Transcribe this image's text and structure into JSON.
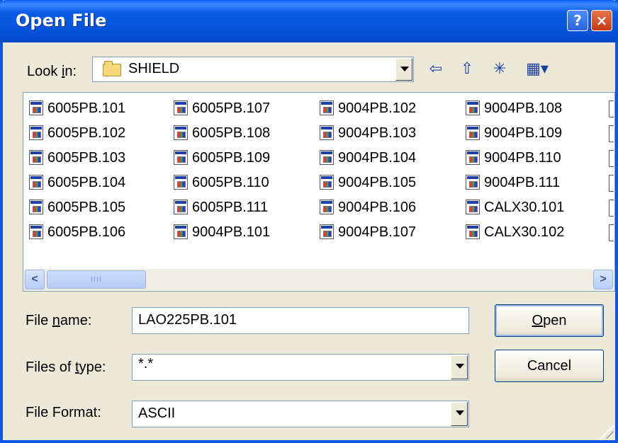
{
  "dialog": {
    "title": "Open File",
    "help_glyph": "?",
    "close_glyph": "×"
  },
  "look_in": {
    "label_pre": "Look ",
    "label_accel": "i",
    "label_post": "n:",
    "value": "SHIELD",
    "icon": "folder-icon"
  },
  "toolbar": {
    "back_icon": "⇦",
    "up_icon": "⇧",
    "new_folder_icon": "✳",
    "view_menu_icon": "▦▾"
  },
  "files": {
    "columns": [
      [
        "6005PB.101",
        "6005PB.102",
        "6005PB.103",
        "6005PB.104",
        "6005PB.105",
        "6005PB.106"
      ],
      [
        "6005PB.107",
        "6005PB.108",
        "6005PB.109",
        "6005PB.110",
        "6005PB.111",
        "9004PB.101"
      ],
      [
        "9004PB.102",
        "9004PB.103",
        "9004PB.104",
        "9004PB.105",
        "9004PB.106",
        "9004PB.107"
      ],
      [
        "9004PB.108",
        "9004PB.109",
        "9004PB.110",
        "9004PB.111",
        "CALX30.101",
        "CALX30.102"
      ]
    ]
  },
  "scrollbar": {
    "left_glyph": "<",
    "right_glyph": ">",
    "thumb_grip": "IIII"
  },
  "file_name": {
    "label_pre": "File ",
    "label_accel": "n",
    "label_post": "ame:",
    "value": "LAO225PB.101"
  },
  "file_type": {
    "label_pre": "Files of ",
    "label_accel": "t",
    "label_post": "ype:",
    "value": "*.*"
  },
  "file_format": {
    "label": "File Format:",
    "value": "ASCII"
  },
  "buttons": {
    "open_accel": "O",
    "open_rest": "pen",
    "cancel": "Cancel"
  }
}
